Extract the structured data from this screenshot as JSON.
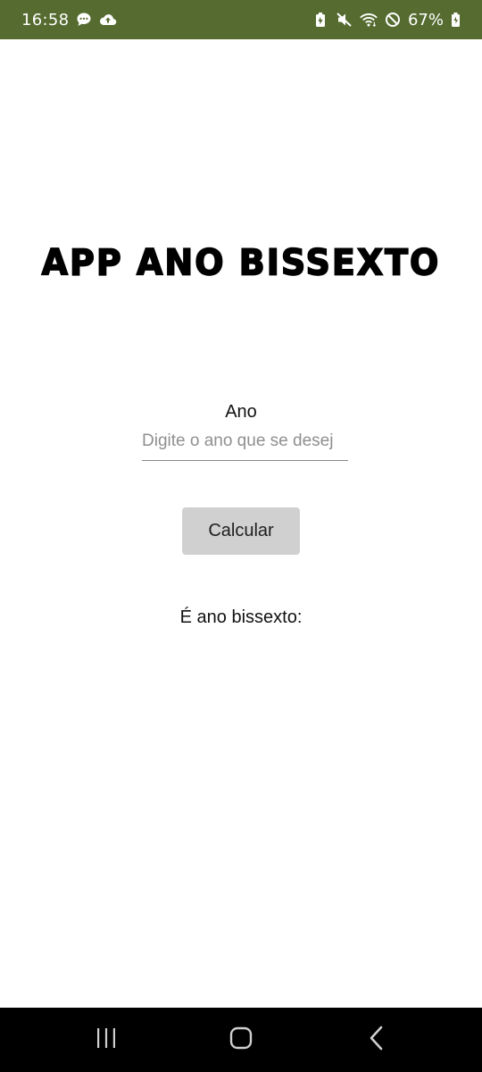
{
  "status_bar": {
    "time": "16:58",
    "battery_percent": "67%",
    "background_color": "#556b2f",
    "left_icons": [
      "chat-bubble-icon",
      "cloud-upload-icon"
    ],
    "right_icons": [
      "battery-saver-icon",
      "mute-icon",
      "wifi-icon",
      "do-not-disturb-icon",
      "battery-icon"
    ]
  },
  "main": {
    "title": "APP ANO BISSEXTO",
    "input_label": "Ano",
    "input_value": "",
    "input_placeholder": "Digite o ano que se desej",
    "button_label": "Calcular",
    "result_label": "É ano bissexto:"
  },
  "nav_bar": {
    "buttons": [
      "recents-icon",
      "home-icon",
      "back-icon"
    ]
  }
}
